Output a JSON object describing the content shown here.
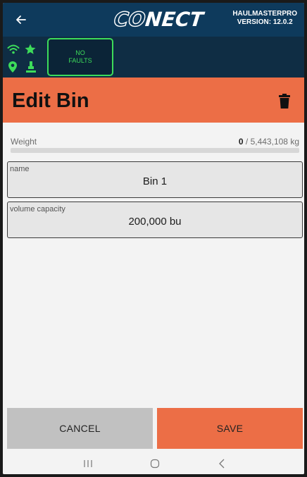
{
  "app": {
    "logo_prefix": "CO",
    "logo_suffix": "NECT",
    "product": "HAULMASTERPRO",
    "version": "VERSION: 12.0.2"
  },
  "status": {
    "fault_text": "NO FAULTS",
    "indicator_color": "#3ddc5a",
    "icons": [
      "wifi-icon",
      "star-icon",
      "location-pin-icon",
      "equipment-icon"
    ]
  },
  "page": {
    "title": "Edit Bin",
    "accent_color": "#ec6e46"
  },
  "weight": {
    "label": "Weight",
    "current": "0",
    "separator": " / ",
    "max": "5,443,108",
    "unit": "kg",
    "fill_fraction": 0
  },
  "fields": {
    "name": {
      "label": "name",
      "value": "Bin 1"
    },
    "volume": {
      "label": "volume capacity",
      "value": "200,000 bu"
    }
  },
  "buttons": {
    "cancel": "CANCEL",
    "save": "SAVE"
  }
}
